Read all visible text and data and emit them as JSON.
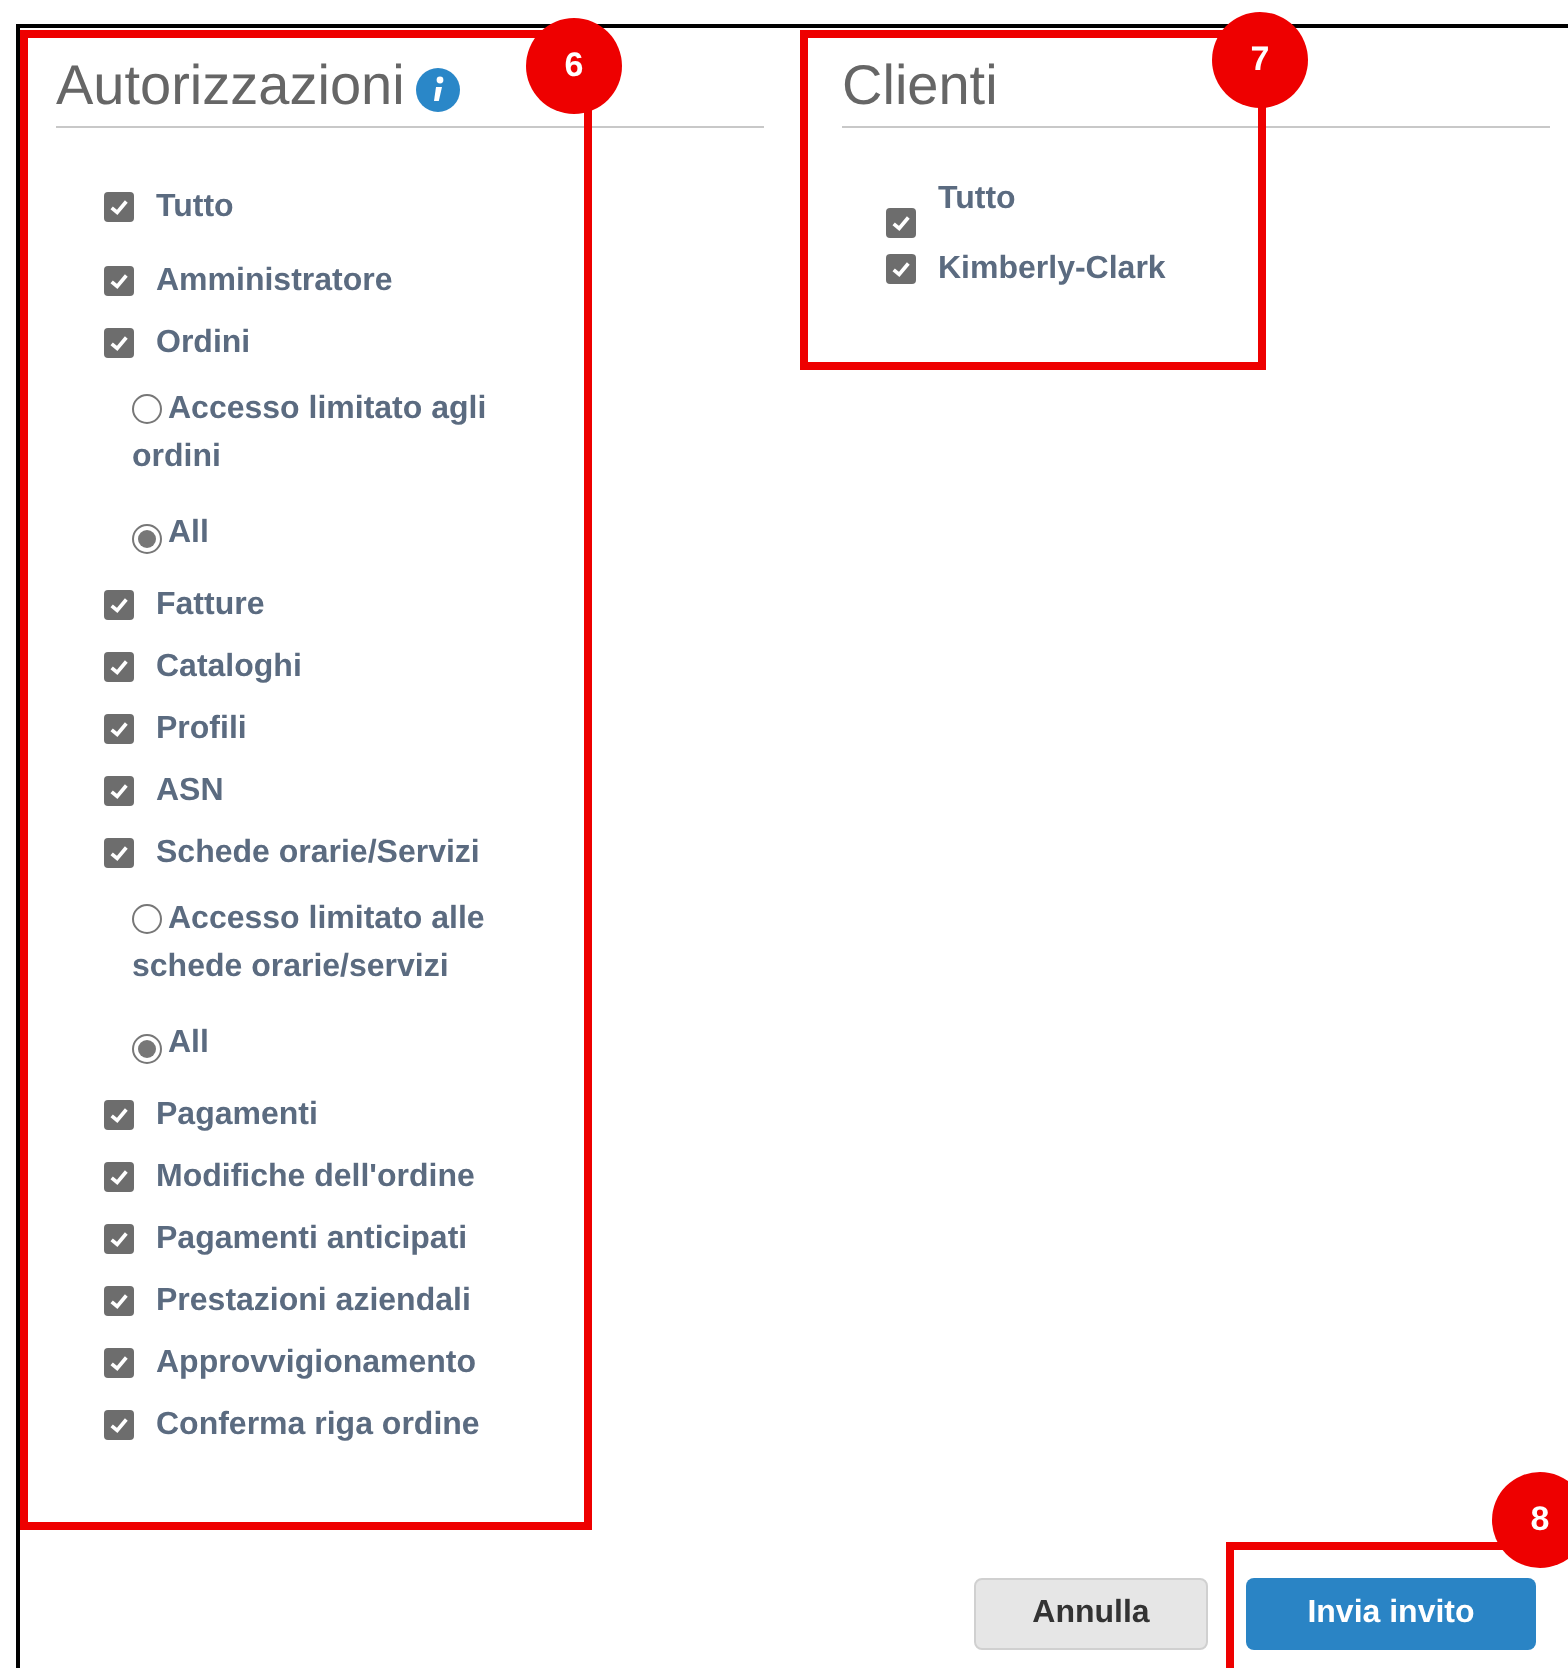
{
  "permissions": {
    "title": "Autorizzazioni",
    "callout": "6",
    "items": [
      {
        "label": "Tutto",
        "checked": true
      },
      {
        "label": "Amministratore",
        "checked": true
      },
      {
        "label": "Ordini",
        "checked": true,
        "options": [
          {
            "label": "Accesso limitato agli ordini",
            "selected": false
          },
          {
            "label": "All",
            "selected": true
          }
        ]
      },
      {
        "label": "Fatture",
        "checked": true
      },
      {
        "label": "Cataloghi",
        "checked": true
      },
      {
        "label": "Profili",
        "checked": true
      },
      {
        "label": "ASN",
        "checked": true
      },
      {
        "label": "Schede orarie/Servizi",
        "checked": true,
        "options": [
          {
            "label": "Accesso limitato alle schede orarie/servizi",
            "selected": false
          },
          {
            "label": "All",
            "selected": true
          }
        ]
      },
      {
        "label": "Pagamenti",
        "checked": true
      },
      {
        "label": "Modifiche dell'ordine",
        "checked": true
      },
      {
        "label": "Pagamenti anticipati",
        "checked": true
      },
      {
        "label": "Prestazioni aziendali",
        "checked": true
      },
      {
        "label": "Approvvigionamento",
        "checked": true
      },
      {
        "label": "Conferma riga ordine",
        "checked": true
      }
    ]
  },
  "clients": {
    "title": "Clienti",
    "callout": "7",
    "items": [
      {
        "label": "Tutto",
        "checked": true
      },
      {
        "label": "Kimberly-Clark",
        "checked": true
      }
    ]
  },
  "actions": {
    "callout": "8",
    "buttons": [
      {
        "label": "Annulla",
        "kind": "secondary"
      },
      {
        "label": "Invia invito",
        "kind": "primary"
      }
    ]
  }
}
